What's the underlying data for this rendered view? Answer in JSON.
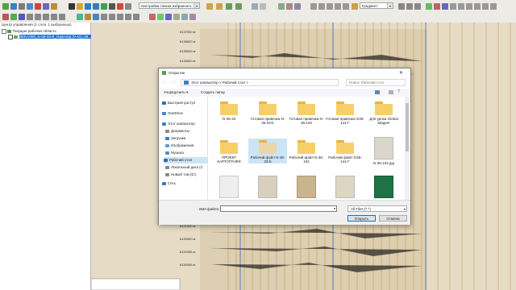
{
  "toolbar": {
    "layer_combo": "Настройка списка избранного...",
    "gradient_label": "Градиент",
    "color_combo": "Цвет Lidar \\ RGB \\ Elev"
  },
  "left_panel": {
    "title": "Центр управления (1 слоя, 1 выбранных)",
    "workspace": "Текущая рабочая область",
    "layer": "8KKAЛ50_N-36-33-В_Ущатлад (V-41)_08..."
  },
  "map": {
    "ticks": [
      "6137000 м",
      "6136000 м",
      "6135000 м",
      "6134000 м",
      "6133000 м",
      "6132000 м",
      "6131000 м",
      "6130000 м",
      "6129000 м",
      "6128000 м",
      "6127000 м",
      "6126000 м",
      "6125000 м",
      "6124000 м",
      "6123000 м",
      "6122000 м",
      "6121000 м",
      "6120000 м",
      "6119000 м",
      "6118000 м"
    ]
  },
  "dialog": {
    "title": "Открытие",
    "breadcrumb": [
      "Этот компьютер",
      "Рабочий стол"
    ],
    "search_placeholder": "Поиск: Рабочий стол",
    "organize": "Упорядочить ▾",
    "new_folder": "Создать папку",
    "nav": [
      {
        "label": "Быстрый доступ",
        "icon": "star-icon"
      },
      {
        "label": "OneDrive",
        "icon": "cloud-icon"
      },
      {
        "label": "Этот компьютер",
        "icon": "computer-icon"
      },
      {
        "label": "Документы",
        "icon": "documents-icon"
      },
      {
        "label": "Загрузки",
        "icon": "downloads-icon"
      },
      {
        "label": "Изображения",
        "icon": "pictures-icon"
      },
      {
        "label": "Музыка",
        "icon": "music-icon"
      },
      {
        "label": "Рабочий стол",
        "icon": "desktop-icon"
      },
      {
        "label": "Локальный диск (C",
        "icon": "drive-icon"
      },
      {
        "label": "Новый том (D:)",
        "icon": "drive-icon"
      },
      {
        "label": "Сеть",
        "icon": "network-icon"
      }
    ],
    "files": [
      {
        "name": "N-36-33",
        "kind": "folder"
      },
      {
        "name": "Готовая привязка N-36-33-b",
        "kind": "folder"
      },
      {
        "name": "Готовая привязка N-36-102",
        "kind": "folder"
      },
      {
        "name": "Готовая привязка O36-141-Г",
        "kind": "folder"
      },
      {
        "name": "Для урока Global Mapper",
        "kind": "folder"
      },
      {
        "name": "ПРОЕКТ КАРТОГРАФФ",
        "kind": "folder"
      },
      {
        "name": "Рабочий файл N-36-33-b",
        "kind": "folder"
      },
      {
        "name": "Рабочий файл N-36-102",
        "kind": "folder"
      },
      {
        "name": "Рабочий файл O36-141-Г",
        "kind": "folder"
      },
      {
        "name": "N-36-102.jpg",
        "kind": "image"
      },
      {
        "name": "",
        "kind": "image"
      },
      {
        "name": "",
        "kind": "image"
      },
      {
        "name": "",
        "kind": "image"
      },
      {
        "name": "",
        "kind": "image"
      },
      {
        "name": "",
        "kind": "excel"
      }
    ],
    "filename_label": "Имя файла:",
    "filename_value": "",
    "filter": "All Files (*.*)",
    "open_button": "Открыть",
    "cancel_button": "Отмена"
  }
}
